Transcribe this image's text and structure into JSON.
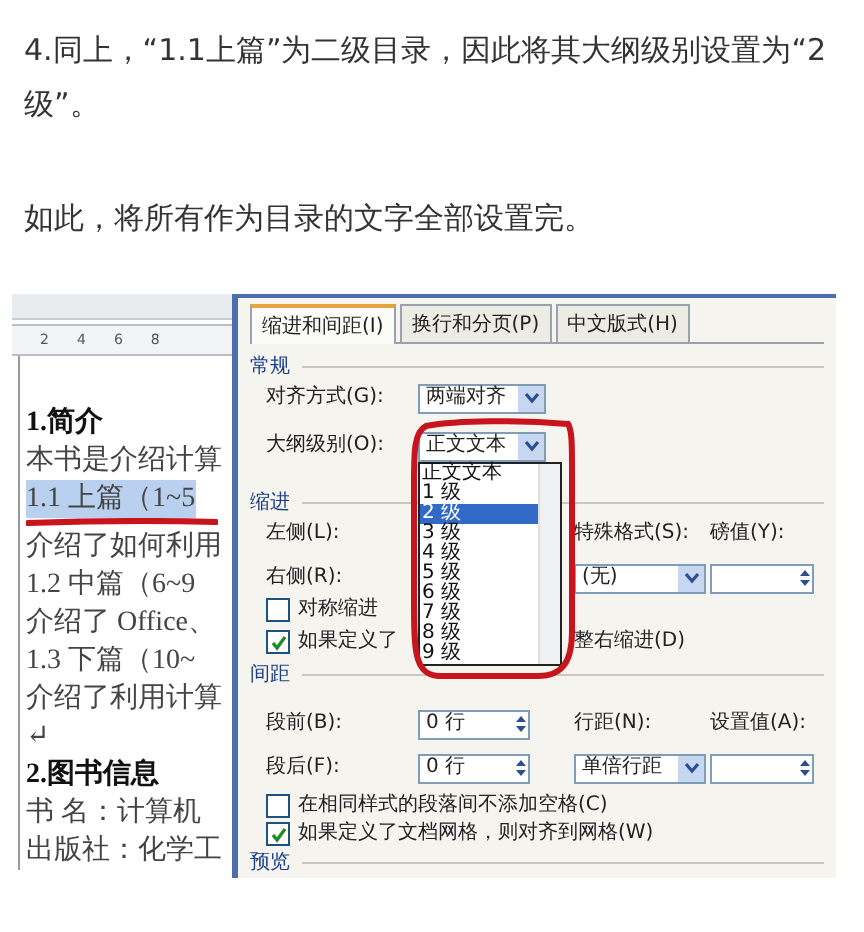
{
  "article": {
    "paragraphs": [
      "4.同上，“1.1上篇”为二级目录，因此将其大纲级别设置为“2级”。",
      "如此，将所有作为目录的文字全部设置完。"
    ]
  },
  "document": {
    "ruler_marks": [
      "2",
      "4",
      "6",
      "8"
    ],
    "lines": [
      {
        "text": "1.简介",
        "kind": "heading",
        "selected": false
      },
      {
        "text": "本书是介绍计算",
        "kind": "body",
        "selected": false
      },
      {
        "text": "1.1 上篇（1~5",
        "kind": "body",
        "selected": true
      },
      {
        "text": "介绍了如何利用",
        "kind": "body",
        "selected": false
      },
      {
        "text": "1.2 中篇（6~9",
        "kind": "body",
        "selected": false
      },
      {
        "text": "介绍了 Office、",
        "kind": "body",
        "selected": false
      },
      {
        "text": "1.3 下篇（10~",
        "kind": "body",
        "selected": false
      },
      {
        "text": "介绍了利用计算",
        "kind": "body",
        "selected": false
      },
      {
        "text": "↵",
        "kind": "body",
        "selected": false
      },
      {
        "text": "2.图书信息",
        "kind": "heading",
        "selected": false
      },
      {
        "text": "书  名：计算机",
        "kind": "body",
        "selected": false
      },
      {
        "text": "出版社：化学工",
        "kind": "body",
        "selected": false
      }
    ]
  },
  "dialog": {
    "tabs": [
      {
        "label": "缩进和间距(I)",
        "selected": true
      },
      {
        "label": "换行和分页(P)",
        "selected": false
      },
      {
        "label": "中文版式(H)",
        "selected": false
      }
    ],
    "general": {
      "title": "常规",
      "alignment": {
        "label": "对齐方式(G):",
        "value": "两端对齐"
      },
      "outline_level": {
        "label": "大纲级别(O):",
        "value": "正文文本",
        "expanded": true,
        "options": [
          {
            "label": "正文文本",
            "highlighted": false
          },
          {
            "label": "1 级",
            "highlighted": false
          },
          {
            "label": "2 级",
            "highlighted": true
          },
          {
            "label": "3 级",
            "highlighted": false
          },
          {
            "label": "4 级",
            "highlighted": false
          },
          {
            "label": "5 级",
            "highlighted": false
          },
          {
            "label": "6 级",
            "highlighted": false
          },
          {
            "label": "7 级",
            "highlighted": false
          },
          {
            "label": "8 级",
            "highlighted": false
          },
          {
            "label": "9 级",
            "highlighted": false
          }
        ]
      }
    },
    "indent": {
      "title": "缩进",
      "left_label": "左侧(L):",
      "right_label": "右侧(R):",
      "special": {
        "label": "特殊格式(S):",
        "value": "(无)"
      },
      "by": {
        "label": "磅值(Y):"
      },
      "checkboxes": [
        {
          "label": "对称缩进",
          "checked": false
        },
        {
          "label": "如果定义了",
          "label_end": "整右缩进(D)",
          "checked": true
        }
      ]
    },
    "spacing": {
      "title": "间距",
      "before": {
        "label": "段前(B):",
        "value": "0 行"
      },
      "after": {
        "label": "段后(F):",
        "value": "0 行"
      },
      "line_spacing": {
        "label": "行距(N):",
        "value": "单倍行距"
      },
      "at": {
        "label": "设置值(A):"
      },
      "checkboxes": [
        {
          "label": "在相同样式的段落间不添加空格(C)",
          "checked": false
        },
        {
          "label": "如果定义了文档网格，则对齐到网格(W)",
          "checked": true
        }
      ]
    },
    "preview": {
      "title": "预览"
    }
  }
}
